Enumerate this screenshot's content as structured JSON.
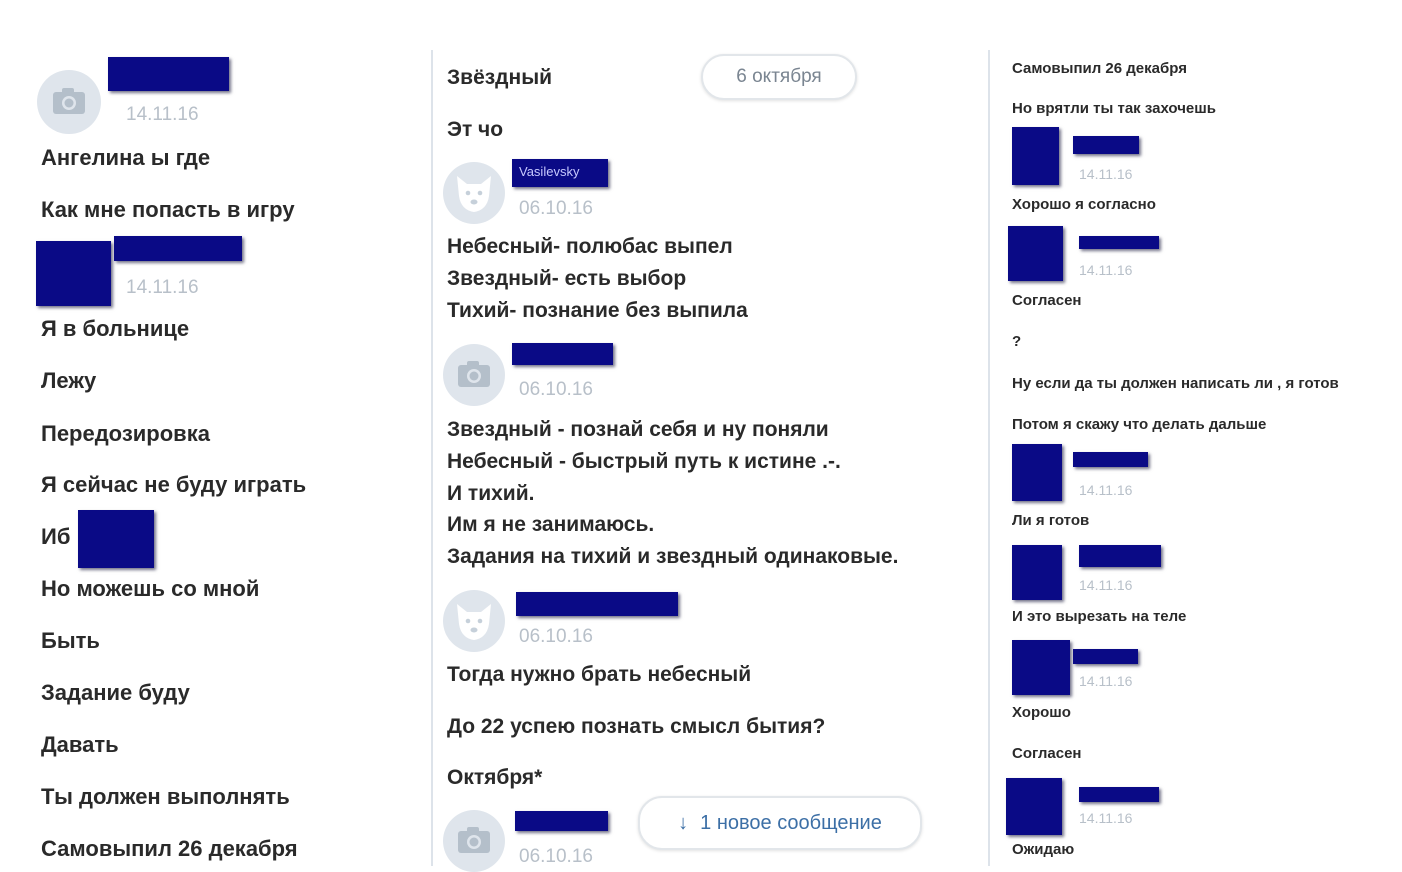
{
  "left": {
    "date1": "14.11.16",
    "messages": [
      "Ангелина ы где",
      "Как мне попасть в игру"
    ],
    "date2": "14.11.16",
    "messages2": [
      "Я в больнице",
      "Лежу",
      "Передозировка",
      "Я сейчас не буду играть",
      "Иб",
      "Но можешь со мной",
      "Быть",
      "Задание буду",
      "Давать",
      "Ты должен выполнять",
      "Самовыпил 26 декабря"
    ]
  },
  "middle": {
    "top_text": "Звёздный",
    "date_pill": "6 октября",
    "msg_et": "Эт чо",
    "sender1_name": "Vasilevsky",
    "sender1_date": "06.10.16",
    "block1": [
      "Небесный- полюбас выпел",
      "Звездный- есть выбор",
      "Тихий- познание без выпила"
    ],
    "sender2_date": "06.10.16",
    "block2": [
      "Звездный - познай себя и ну поняли",
      "Небесный - быстрый путь к истине .-.",
      "И тихий.",
      "Им я не занимаюсь.",
      "Задания на тихий и звездный одинаковые."
    ],
    "sender3_date": "06.10.16",
    "block3": [
      "Тогда нужно брать небесный",
      "До 22 успею познать смысл бытия?",
      "Октября*"
    ],
    "sender4_date": "06.10.16",
    "new_msg_arrow": "↓",
    "new_msg_label": "1 новое сообщение"
  },
  "right": {
    "m1": "Самовыпил 26 декабря",
    "m2": "Но врятли ты так захочешь",
    "d1": "14.11.16",
    "m3": "Хорошо я согласно",
    "d2": "14.11.16",
    "m4": "Согласен",
    "m5": "?",
    "m6": "Ну если да ты должен написать ли , я готов",
    "m7": "Потом я скажу что делать дальше",
    "d3": "14.11.16",
    "m8": "Ли я готов",
    "d4": "14.11.16",
    "m9": "И это вырезать на теле",
    "d5": "14.11.16",
    "m10": "Хорошо",
    "m11": "Согласен",
    "d6": "14.11.16",
    "m12": "Ожидаю"
  },
  "colors": {
    "redaction": "#0a0a86",
    "avatar_bg": "#dfe5ec",
    "date": "#b8c0c9",
    "link": "#3c6fa6"
  },
  "icons": [
    "camera-icon",
    "dog-icon",
    "arrow-down-icon"
  ]
}
